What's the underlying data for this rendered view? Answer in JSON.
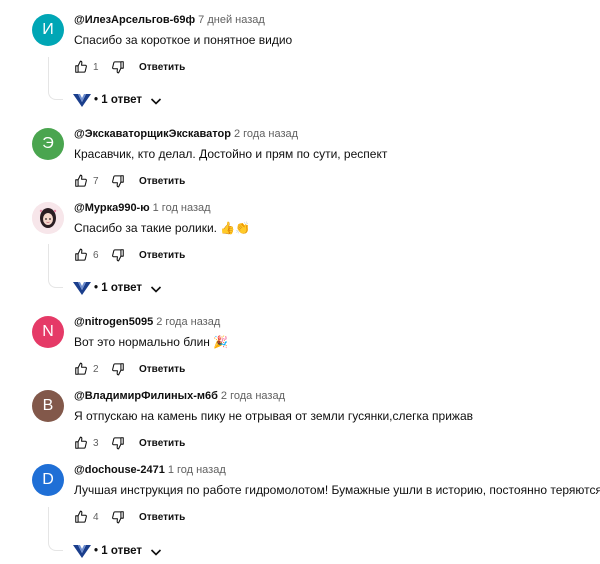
{
  "comments": [
    {
      "author": "@ИлезАрсельгов-69ф",
      "time": "7 дней назад",
      "text": "Спасибо за короткое и понятное видио",
      "likes": "1",
      "reply_label": "Ответить",
      "avatar_letter": "И",
      "avatar_color": "#00a6b5",
      "replies_label": "1 ответ"
    },
    {
      "author": "@ЭкскаваторщикЭкскаватор",
      "time": "2 года назад",
      "text": "Красавчик, кто делал. Достойно и прям по сути, респект",
      "likes": "7",
      "reply_label": "Ответить",
      "avatar_letter": "Э",
      "avatar_color": "#4aa54f"
    },
    {
      "author": "@Мурка990-ю",
      "time": "1 год назад",
      "text": "Спасибо за такие ролики. 👍👏",
      "likes": "6",
      "reply_label": "Ответить",
      "avatar_letter": "",
      "avatar_color": "#f7e6ea",
      "replies_label": "1 ответ"
    },
    {
      "author": "@nitrogen5095",
      "time": "2 года назад",
      "text": "Вот это нормально блин 🎉",
      "likes": "2",
      "reply_label": "Ответить",
      "avatar_letter": "N",
      "avatar_color": "#e53a67"
    },
    {
      "author": "@ВладимирФилиных-м6б",
      "time": "2 года назад",
      "text": "Я отпускаю на камень пику не отрывая от земли гусянки,слегка прижав",
      "likes": "3",
      "reply_label": "Ответить",
      "avatar_letter": "В",
      "avatar_color": "#82584a"
    },
    {
      "author": "@dochouse-2471",
      "time": "1 год назад",
      "text": "Лучшая инструкция по работе гидромолотом! Бумажные ушли в историю, постоянно теряются.",
      "likes": "4",
      "reply_label": "Ответить",
      "avatar_letter": "D",
      "avatar_color": "#1f6fd6",
      "replies_label": "1 ответ"
    }
  ],
  "icons": {
    "like": "thumb-up-icon",
    "dislike": "thumb-down-icon",
    "creator": "channel-logo-icon",
    "expand": "chevron-down-icon"
  },
  "colors": {
    "creator_logo_blue": "#1a3e8c",
    "time_gray": "#606060"
  }
}
